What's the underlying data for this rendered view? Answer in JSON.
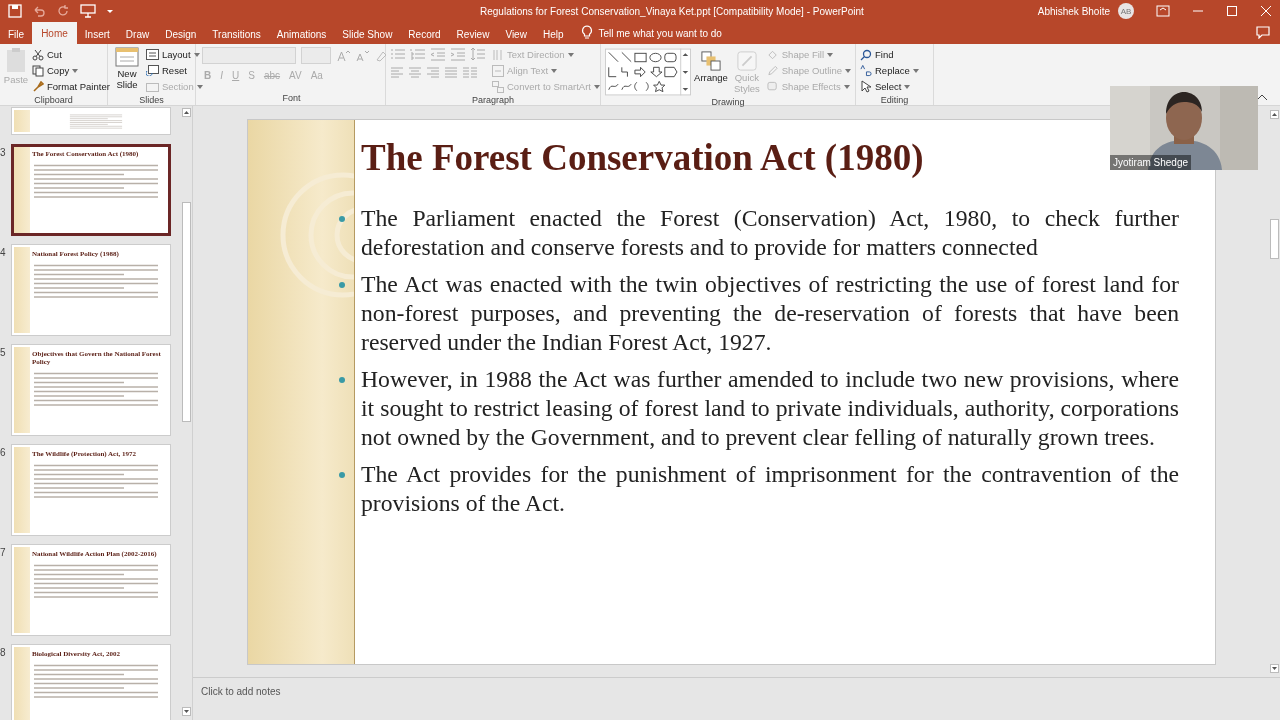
{
  "window": {
    "title": "Regulations for Forest  Conservation_Vinaya Ket.ppt [Compatibility Mode]  -  PowerPoint",
    "user": "Abhishek Bhoite",
    "user_initials": "AB"
  },
  "menu_tabs": [
    {
      "label": "File",
      "selected": false
    },
    {
      "label": "Home",
      "selected": true
    },
    {
      "label": "Insert",
      "selected": false
    },
    {
      "label": "Draw",
      "selected": false
    },
    {
      "label": "Design",
      "selected": false
    },
    {
      "label": "Transitions",
      "selected": false
    },
    {
      "label": "Animations",
      "selected": false
    },
    {
      "label": "Slide Show",
      "selected": false
    },
    {
      "label": "Record",
      "selected": false
    },
    {
      "label": "Review",
      "selected": false
    },
    {
      "label": "View",
      "selected": false
    },
    {
      "label": "Help",
      "selected": false
    }
  ],
  "tell_me": "Tell me what you want to do",
  "ribbon": {
    "clipboard": {
      "label": "Clipboard",
      "paste": {
        "label": "Paste",
        "disabled": true
      },
      "cut": {
        "label": "Cut",
        "disabled": false
      },
      "copy": {
        "label": "Copy",
        "disabled": false
      },
      "format_painter": {
        "label": "Format Painter",
        "disabled": false
      }
    },
    "slides": {
      "label": "Slides",
      "new_slide": {
        "label": "New Slide",
        "disabled": false
      },
      "layout": {
        "label": "Layout",
        "disabled": false
      },
      "reset": {
        "label": "Reset",
        "disabled": false
      },
      "section": {
        "label": "Section",
        "disabled": true
      }
    },
    "font": {
      "label": "Font",
      "buttons": [
        {
          "label": "B",
          "disabled": true
        },
        {
          "label": "I",
          "disabled": true
        },
        {
          "label": "U",
          "disabled": true
        },
        {
          "label": "S",
          "disabled": true
        },
        {
          "label": "abc",
          "disabled": true
        },
        {
          "label": "AV",
          "disabled": true
        },
        {
          "label": "Aa",
          "disabled": true
        }
      ]
    },
    "paragraph": {
      "label": "Paragraph",
      "text_direction": {
        "label": "Text Direction",
        "disabled": true
      },
      "align_text": {
        "label": "Align Text",
        "disabled": true
      },
      "convert_smartart": {
        "label": "Convert to SmartArt",
        "disabled": true
      }
    },
    "drawing": {
      "label": "Drawing",
      "arrange": {
        "label": "Arrange",
        "disabled": false
      },
      "quick_styles": {
        "label": "Quick Styles",
        "disabled": true
      },
      "shape_fill": {
        "label": "Shape Fill",
        "disabled": true
      },
      "shape_outline": {
        "label": "Shape Outline",
        "disabled": true
      },
      "shape_effects": {
        "label": "Shape Effects",
        "disabled": true
      }
    },
    "editing": {
      "label": "Editing",
      "find": {
        "label": "Find",
        "disabled": false
      },
      "replace": {
        "label": "Replace",
        "disabled": false
      },
      "select": {
        "label": "Select",
        "disabled": false
      }
    }
  },
  "thumbnails": [
    {
      "kind": "partial",
      "selected": false
    },
    {
      "kind": "full",
      "number": "3",
      "title": "The Forest Conservation Act (1980)",
      "selected": true
    },
    {
      "kind": "full",
      "number": "4",
      "title": "National Forest Policy (1988)",
      "selected": false
    },
    {
      "kind": "full",
      "number": "5",
      "title": "Objectives that Govern the National Forest Policy",
      "selected": false
    },
    {
      "kind": "full",
      "number": "6",
      "title": "The Wildlife (Protection) Act, 1972",
      "selected": false
    },
    {
      "kind": "full",
      "number": "7",
      "title": "National Wildlife Action Plan (2002-2016)",
      "selected": false
    },
    {
      "kind": "full",
      "number": "8",
      "title": "Biological Diversity Act, 2002",
      "selected": false
    }
  ],
  "slide": {
    "title": "The Forest Conservation Act (1980)",
    "bullets": [
      "The Parliament enacted the Forest (Conservation) Act, 1980, to check further deforestation and conserve forests and to provide for matters connected",
      "The Act was enacted with the twin objectives of restricting the use of forest land for non-forest purposes, and preventing the de-reservation of forests that have been reserved under the Indian Forest Act, 1927.",
      "However, in 1988 the Act was further amended to include two new provisions, where it sought to restrict leasing of forest land to private individuals, authority, corporations not owned by the Government, and to prevent clear felling of naturally grown trees.",
      "The Act provides for the punishment of imprisonment for the contravention of the provisions of the Act."
    ]
  },
  "notes": {
    "placeholder": "Click to add notes"
  },
  "video": {
    "caption": "Jyotiram Shedge"
  }
}
